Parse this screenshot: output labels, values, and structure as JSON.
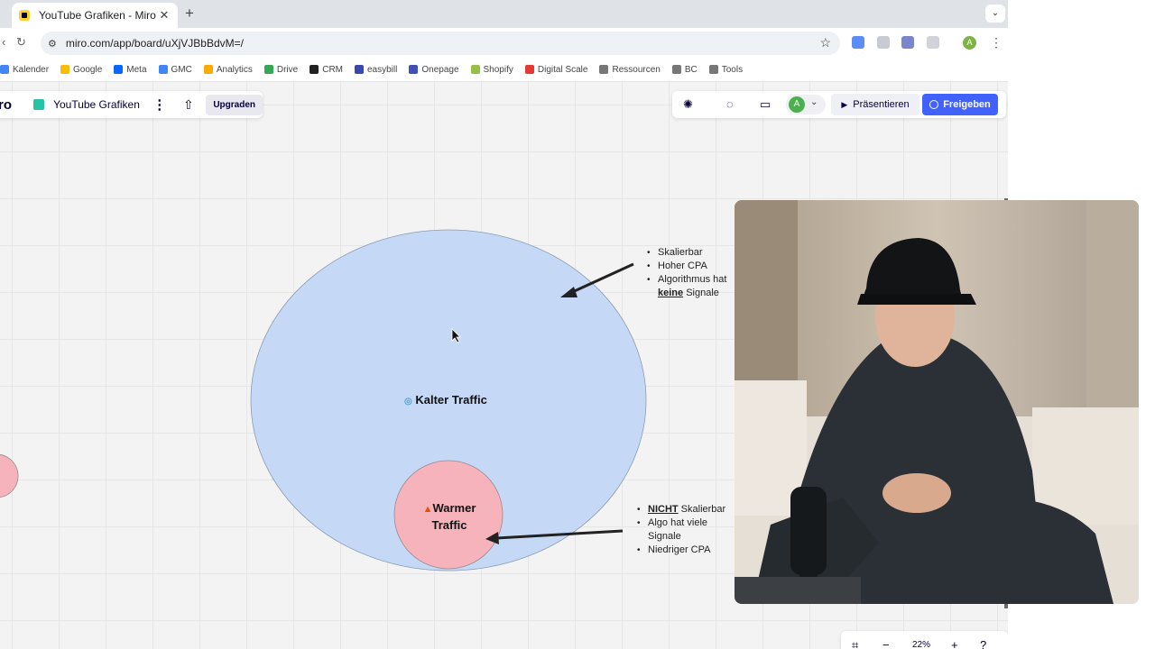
{
  "tab": {
    "title": "YouTube Grafiken - Miro",
    "close": "✕",
    "new_tab": "+"
  },
  "address_bar": {
    "url": "miro.com/app/board/uXjVJBbBdvM=/"
  },
  "bookmarks": [
    {
      "label": "Kalender",
      "color": "#4285f4"
    },
    {
      "label": "Google",
      "color": "#fbbc05"
    },
    {
      "label": "Meta",
      "color": "#0866ff"
    },
    {
      "label": "GMC",
      "color": "#4285f4"
    },
    {
      "label": "Analytics",
      "color": "#f9ab00"
    },
    {
      "label": "Drive",
      "color": "#34a853"
    },
    {
      "label": "CRM",
      "color": "#222222"
    },
    {
      "label": "easybill",
      "color": "#3949ab"
    },
    {
      "label": "Onepage",
      "color": "#3f51b5"
    },
    {
      "label": "Shopify",
      "color": "#95bf47"
    },
    {
      "label": "Digital Scale",
      "color": "#e53935"
    },
    {
      "label": "Ressourcen",
      "color": "#777777"
    },
    {
      "label": "BC",
      "color": "#777777"
    },
    {
      "label": "Tools",
      "color": "#777777"
    }
  ],
  "profile": {
    "initial": "A",
    "color": "#7cb342"
  },
  "miro_top_left": {
    "logo_fragment": "ro",
    "board_name": "YouTube Grafiken",
    "upgrade_label": "Upgraden"
  },
  "miro_top_right": {
    "collaborator_initial": "A",
    "present_label": "Präsentieren",
    "share_label": "Freigeben",
    "accent": "#4262ff"
  },
  "diagram": {
    "cold_label": "Kalter Traffic",
    "warm_label": "Warmer Traffic",
    "cold_color": "#c5d9f7",
    "warm_color": "#f7b3bb",
    "cold_notes": {
      "items": [
        "Skalierbar",
        "Hoher CPA",
        "Algorithmus hat"
      ],
      "last_bold": "keine",
      "last_rest": " Signale"
    },
    "warm_notes": {
      "first_bold": "NICHT",
      "first_rest": " Skalierbar",
      "items": [
        "Algo hat viele",
        "Signale",
        "Niedriger CPA"
      ]
    }
  },
  "zoom": {
    "level": "22%"
  }
}
